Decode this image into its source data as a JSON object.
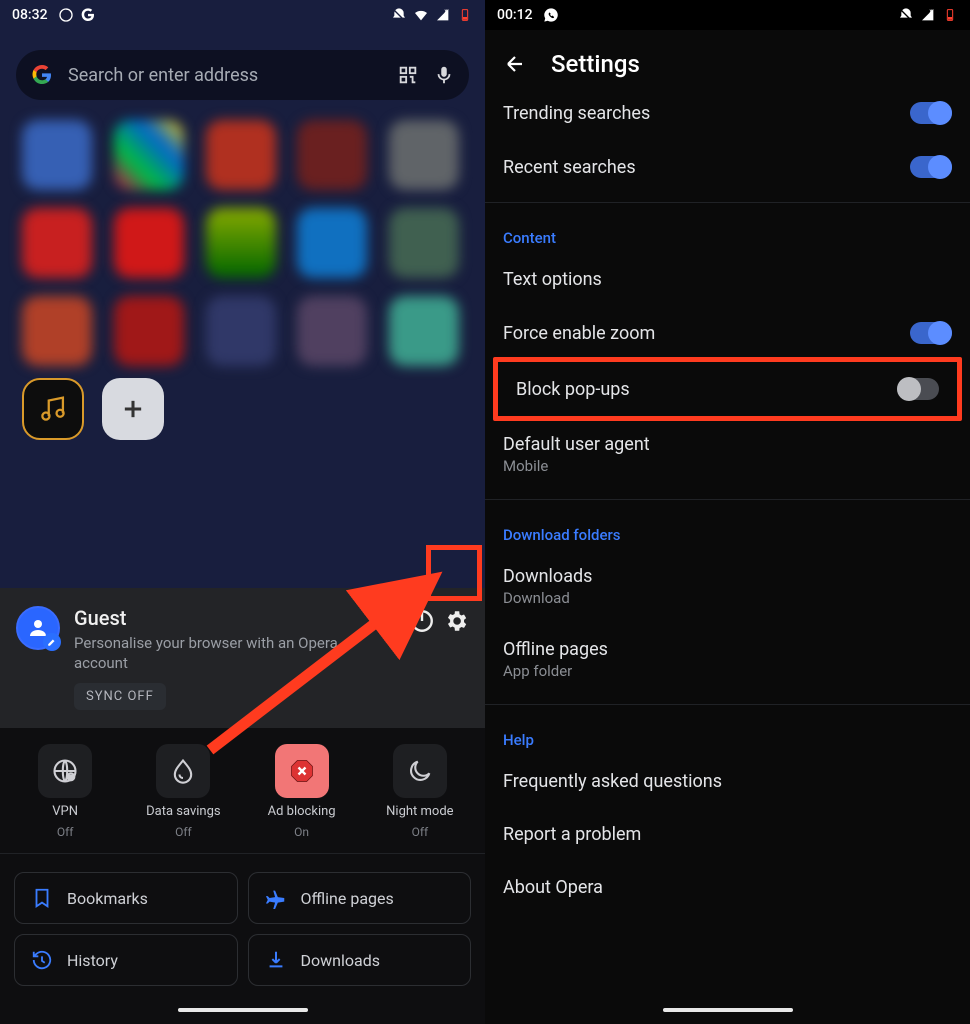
{
  "left": {
    "time": "08:32",
    "search_placeholder": "Search or enter address",
    "account": {
      "title": "Guest",
      "subtitle": "Personalise your browser with an Opera account",
      "sync": "SYNC OFF"
    },
    "quick": [
      {
        "label": "VPN",
        "sub": "Off"
      },
      {
        "label": "Data savings",
        "sub": "Off"
      },
      {
        "label": "Ad blocking",
        "sub": "On"
      },
      {
        "label": "Night mode",
        "sub": "Off"
      }
    ],
    "links": {
      "bookmarks": "Bookmarks",
      "offline": "Offline pages",
      "history": "History",
      "downloads": "Downloads"
    }
  },
  "right": {
    "time": "00:12",
    "title": "Settings",
    "items": {
      "trending": "Trending searches",
      "recent": "Recent searches",
      "content_h": "Content",
      "text_options": "Text options",
      "force_zoom": "Force enable zoom",
      "block_popups": "Block pop-ups",
      "default_ua": "Default user agent",
      "default_ua_sub": "Mobile",
      "dl_h": "Download folders",
      "downloads": "Downloads",
      "downloads_sub": "Download",
      "offline": "Offline pages",
      "offline_sub": "App folder",
      "help_h": "Help",
      "faq": "Frequently asked questions",
      "report": "Report a problem",
      "about": "About Opera"
    }
  }
}
